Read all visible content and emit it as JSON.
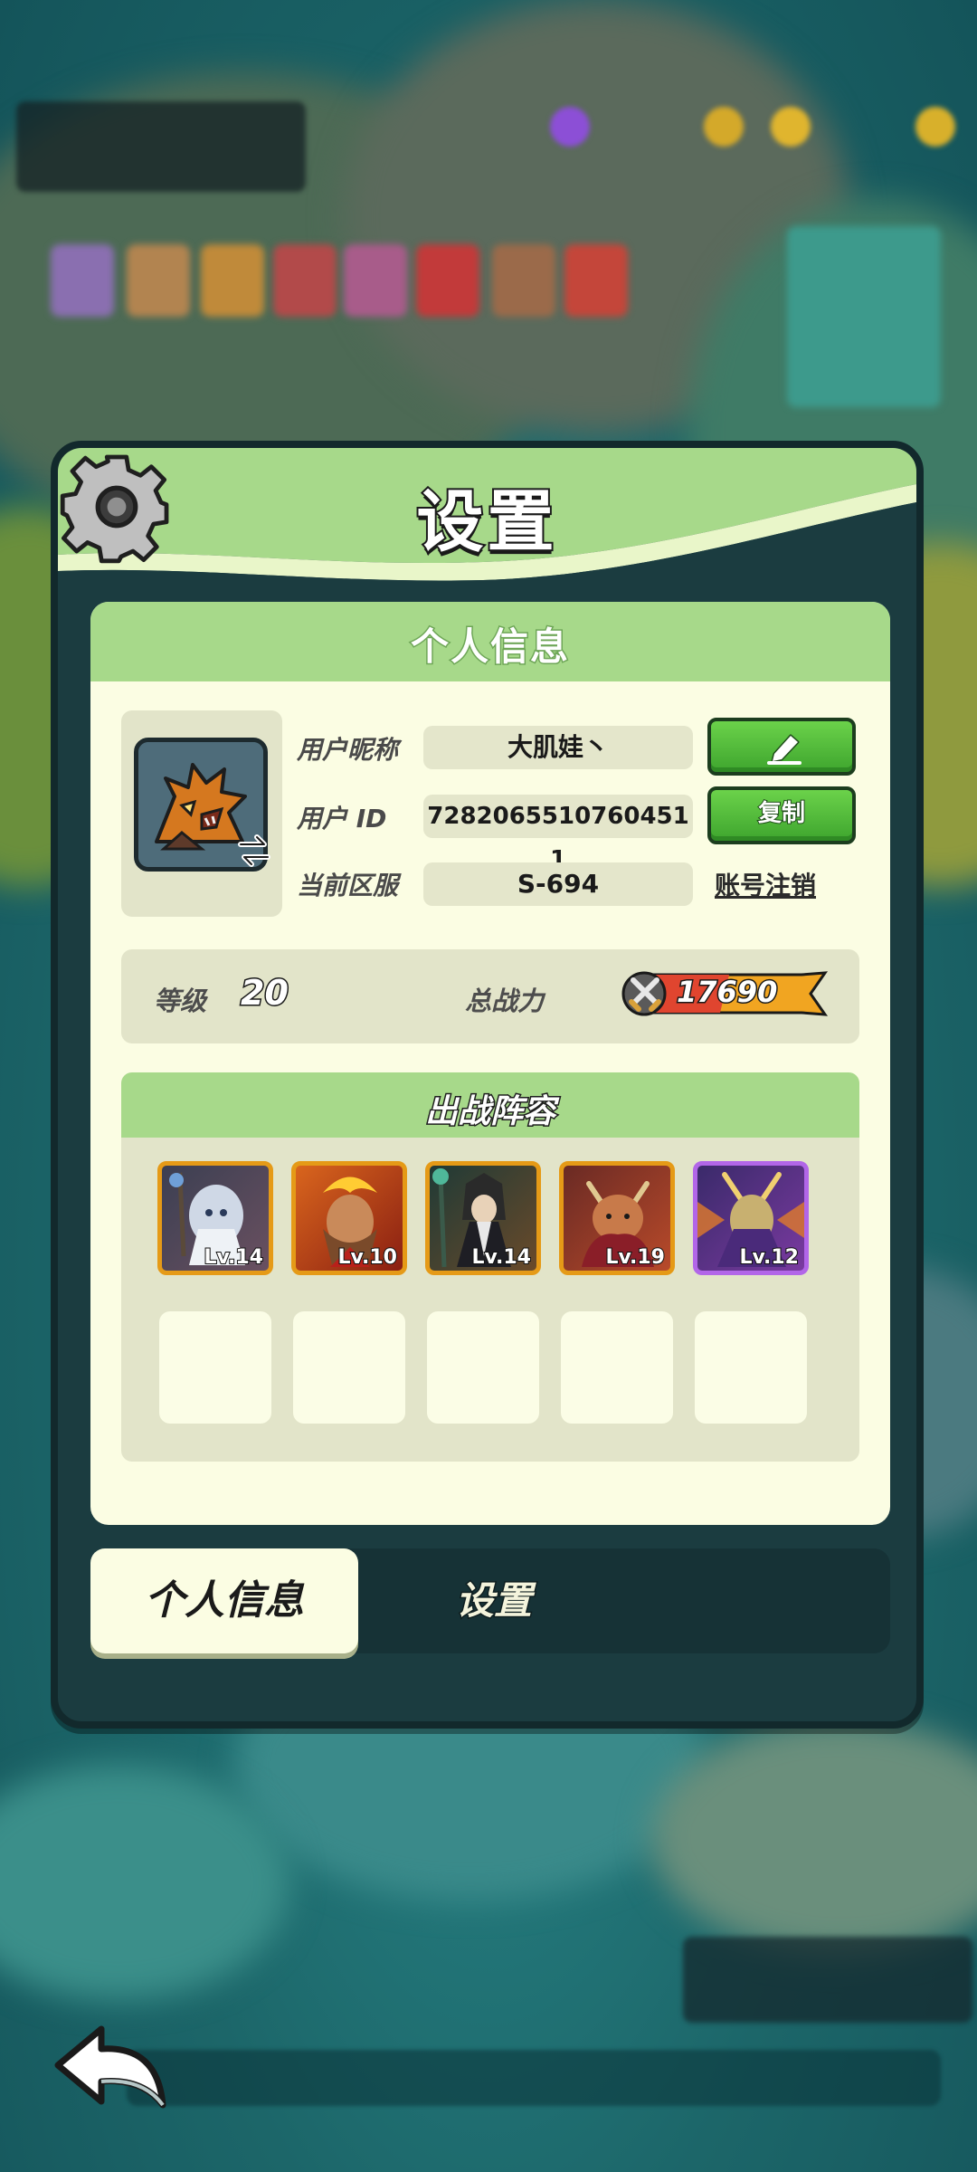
{
  "status_bar": {
    "time": ""
  },
  "dialog": {
    "title": "设置",
    "panel_title": "个人信息",
    "profile": {
      "nickname_label": "用户昵称",
      "nickname": "大肌娃丶",
      "id_label": "用户  ID",
      "user_id": "7282065510760451​1",
      "server_label": "当前区服",
      "server": "S-694",
      "copy_label": "复制",
      "deregister_label": "账号注销"
    },
    "stats": {
      "level_label": "等级",
      "level": "20",
      "power_label": "总战力",
      "power": "17690"
    },
    "lineup": {
      "title": "出战阵容",
      "heroes": [
        {
          "level": "Lv.14",
          "rarity": "orange"
        },
        {
          "level": "Lv.10",
          "rarity": "orange"
        },
        {
          "level": "Lv.14",
          "rarity": "orange"
        },
        {
          "level": "Lv.19",
          "rarity": "orange"
        },
        {
          "level": "Lv.12",
          "rarity": "purple"
        }
      ],
      "empty_slots": 5
    },
    "tabs": [
      {
        "label": "个人信息",
        "active": true
      },
      {
        "label": "设置",
        "active": false
      }
    ]
  },
  "icons": {
    "settings": "gear-icon",
    "edit": "pencil-icon",
    "swap_avatar": "swap-icon",
    "power": "crossed-swords-icon",
    "back": "back-arrow-icon"
  },
  "colors": {
    "header_green": "#a7d98a",
    "button_green": "#4cbc38",
    "panel_cream": "#fbfde3",
    "frame_dark": "#1b3c40",
    "hero_orange_border": "#e59a17",
    "hero_purple_border": "#b266e8"
  }
}
